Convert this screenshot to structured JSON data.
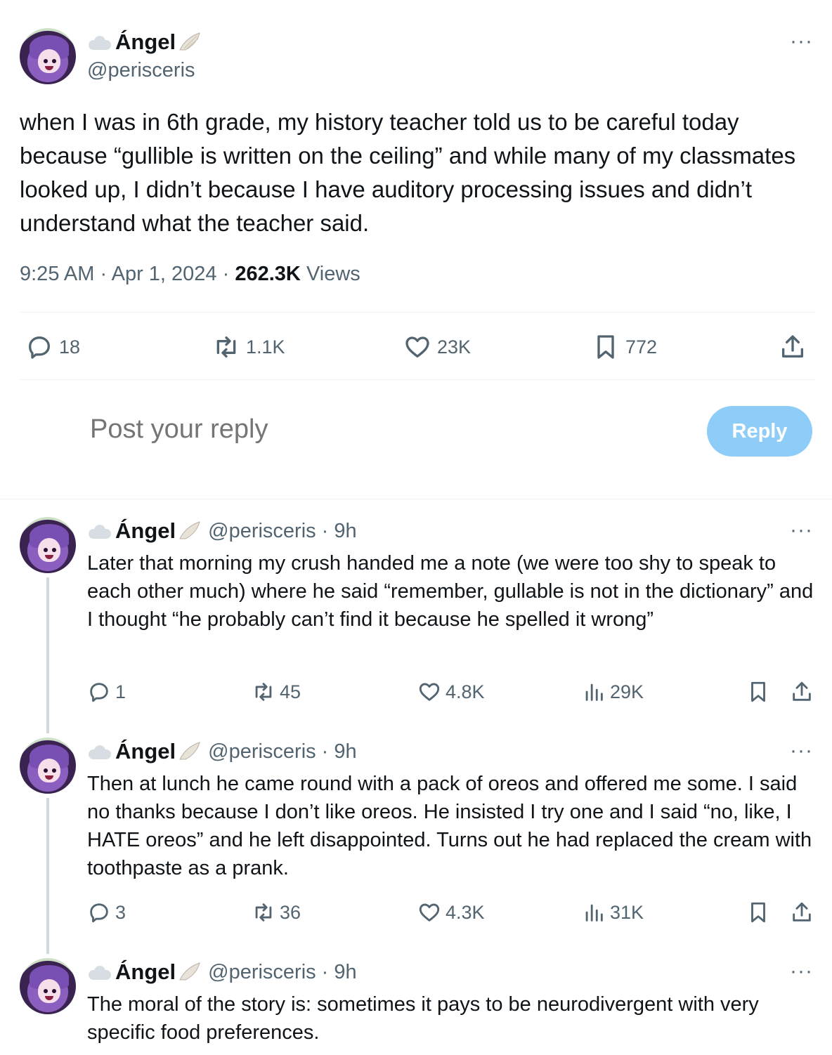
{
  "main_post": {
    "display_name": "Ángel",
    "handle": "@perisceris",
    "text": "when I was in 6th grade, my history teacher told us to be careful today because “gullible is written on the ceiling” and while many of my classmates looked up, I didn’t because I have auditory processing issues and didn’t understand what the teacher said.",
    "time": "9:25 AM",
    "date": "Apr 1, 2024",
    "views_count": "262.3K",
    "views_label": "Views",
    "sep": "·",
    "replies": "18",
    "reposts": "1.1K",
    "likes": "23K",
    "bookmarks": "772"
  },
  "composer": {
    "placeholder": "Post your reply",
    "button_label": "Reply"
  },
  "thread": [
    {
      "display_name": "Ángel",
      "handle": "@perisceris",
      "time": "· 9h",
      "text": "Later that morning my crush handed me a note (we were too shy to speak to each other much) where he said “remember, gullable is not in the dictionary” and I thought “he probably can’t find it because he spelled it wrong”",
      "replies": "1",
      "reposts": "45",
      "likes": "4.8K",
      "views": "29K"
    },
    {
      "display_name": "Ángel",
      "handle": "@perisceris",
      "time": "· 9h",
      "text": "Then at lunch he came round with a pack of oreos and offered me some. I said no thanks because I don’t like oreos. He insisted I try one and I said “no, like, I HATE oreos” and he left disappointed. Turns out he had replaced the cream with toothpaste as a prank.",
      "replies": "3",
      "reposts": "36",
      "likes": "4.3K",
      "views": "31K"
    },
    {
      "display_name": "Ángel",
      "handle": "@perisceris",
      "time": "· 9h",
      "text": "The moral of the story is: sometimes it pays to be neurodivergent with very specific food preferences."
    }
  ],
  "more_label": "···"
}
